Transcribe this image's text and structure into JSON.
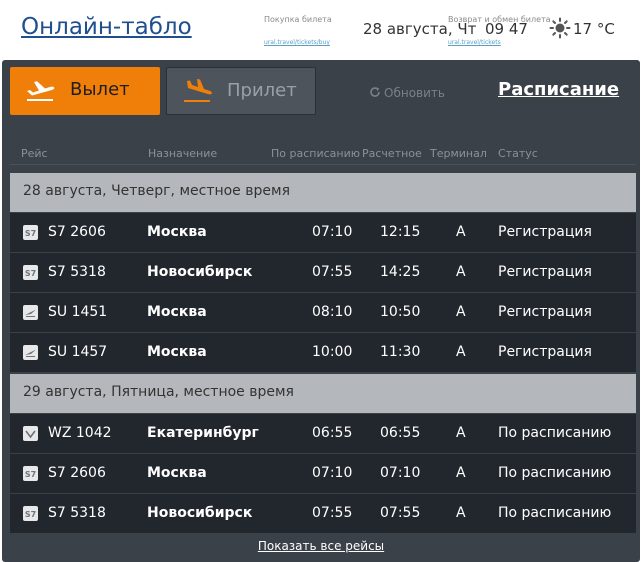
{
  "header": {
    "title": "Онлайн-табло",
    "buy_title": "Покупка билета",
    "buy_sub": "ural.travel/tickets/buy",
    "return_title": "Возврат и обмен билета",
    "return_sub": "ural.travel/tickets",
    "date": "28 августа, Чт",
    "time": "09 47",
    "temperature": "17 °С",
    "weather_icon": "sun-icon"
  },
  "tabs": {
    "departure": "Вылет",
    "arrival": "Прилет",
    "refresh": "Обновить",
    "schedule": "Расписание"
  },
  "columns": {
    "flight": "Рейс",
    "destination": "Назначение",
    "scheduled": "По расписанию",
    "estimated": "Расчетное",
    "terminal": "Терминал",
    "status": "Статус"
  },
  "day1": {
    "label": "28 августа, Четверг, местное время",
    "rows": [
      {
        "airline_icon": "s7-logo",
        "flight": "S7 2606",
        "destination": "Москва",
        "scheduled": "07:10",
        "estimated": "12:15",
        "terminal": "A",
        "status": "Регистрация"
      },
      {
        "airline_icon": "s7-logo",
        "flight": "S7 5318",
        "destination": "Новосибирск",
        "scheduled": "07:55",
        "estimated": "14:25",
        "terminal": "A",
        "status": "Регистрация"
      },
      {
        "airline_icon": "aeroflot-logo",
        "flight": "SU 1451",
        "destination": "Москва",
        "scheduled": "08:10",
        "estimated": "10:50",
        "terminal": "A",
        "status": "Регистрация"
      },
      {
        "airline_icon": "aeroflot-logo",
        "flight": "SU 1457",
        "destination": "Москва",
        "scheduled": "10:00",
        "estimated": "11:30",
        "terminal": "A",
        "status": "Регистрация"
      }
    ]
  },
  "day2": {
    "label": "29 августа, Пятница, местное время",
    "rows": [
      {
        "airline_icon": "wizzair-logo",
        "flight": "WZ 1042",
        "destination": "Екатеринбург",
        "scheduled": "06:55",
        "estimated": "06:55",
        "terminal": "A",
        "status": "По расписанию"
      },
      {
        "airline_icon": "s7-logo",
        "flight": "S7 2606",
        "destination": "Москва",
        "scheduled": "07:10",
        "estimated": "07:10",
        "terminal": "A",
        "status": "По расписанию"
      },
      {
        "airline_icon": "s7-logo",
        "flight": "S7 5318",
        "destination": "Новосибирск",
        "scheduled": "07:55",
        "estimated": "07:55",
        "terminal": "A",
        "status": "По расписанию"
      }
    ]
  },
  "footer": {
    "show_all": "Показать все рейсы"
  },
  "colors": {
    "accent": "#f07f0a",
    "board_bg": "#3b4149",
    "row_bg": "#22272e",
    "date_band_bg": "#b4b8bc",
    "title_blue": "#1f4f8f"
  }
}
